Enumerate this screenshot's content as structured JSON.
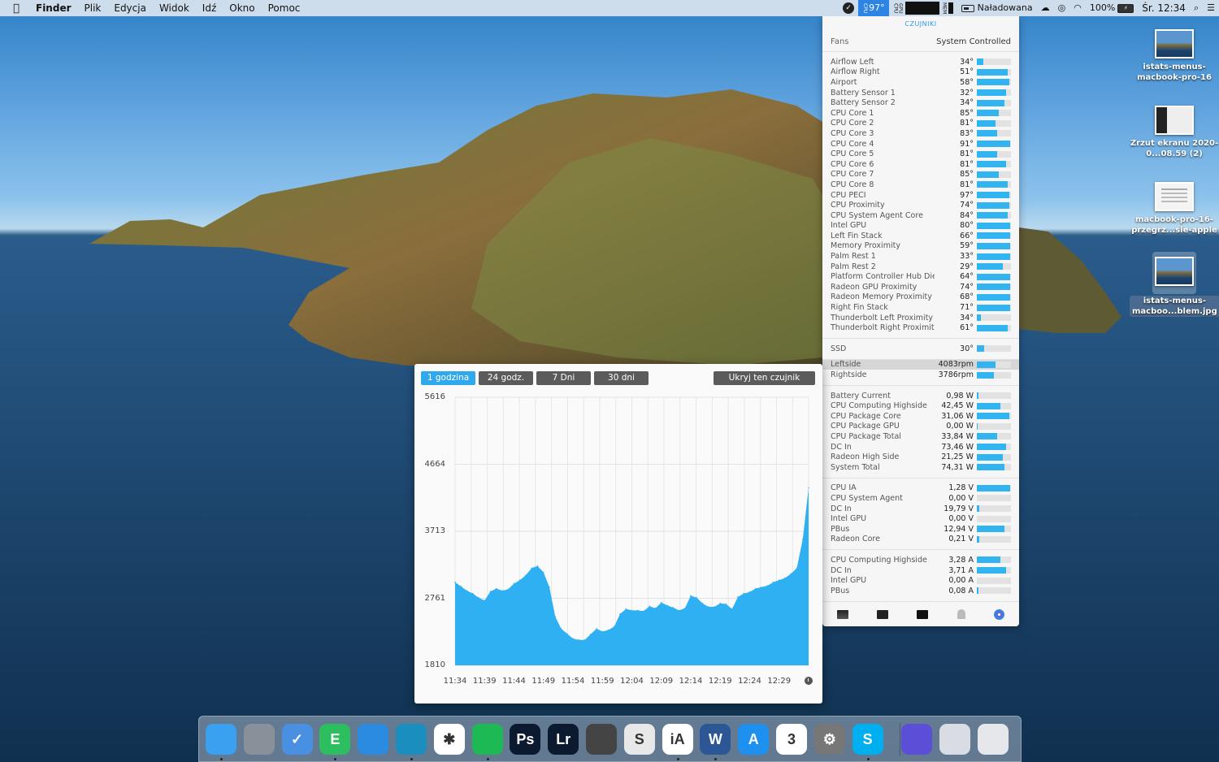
{
  "menubar": {
    "apple": "",
    "items": [
      "Finder",
      "Plik",
      "Edycja",
      "Widok",
      "Idź",
      "Okno",
      "Pomoc"
    ],
    "status": {
      "temperature": "97°",
      "battery_status": "Naładowana",
      "battery_percent": "100%",
      "clock": "Śr. 12:34"
    },
    "icons": [
      "checkmark-icon",
      "cpu-graph-icon",
      "battery-icon",
      "cloud-icon",
      "creative-cloud-icon",
      "wifi-icon",
      "spotlight-icon",
      "notification-center-icon"
    ]
  },
  "desktop_icons": [
    {
      "label": "istats-menus-macbook-pro-16",
      "kind": "photo"
    },
    {
      "label": "Zrzut ekranu 2020-0...08.59 (2)",
      "kind": "screen"
    },
    {
      "label": "macbook-pro-16-przegrz...sie-apple",
      "kind": "doc"
    },
    {
      "label": "istats-menus-macboo...blem.jpg",
      "kind": "photo",
      "selected": true
    }
  ],
  "istat": {
    "header": "CZUJNIKI",
    "fans_label": "Fans",
    "fans_mode": "System Controlled",
    "temperatures": [
      {
        "name": "Airflow Left",
        "value": "34°",
        "level": 0.18
      },
      {
        "name": "Airflow Right",
        "value": "51°",
        "level": 0.9
      },
      {
        "name": "Airport",
        "value": "58°",
        "level": 0.95
      },
      {
        "name": "Battery Sensor 1",
        "value": "32°",
        "level": 0.85
      },
      {
        "name": "Battery Sensor 2",
        "value": "34°",
        "level": 0.8
      },
      {
        "name": "CPU Core 1",
        "value": "85°",
        "level": 0.65
      },
      {
        "name": "CPU Core 2",
        "value": "81°",
        "level": 0.55
      },
      {
        "name": "CPU Core 3",
        "value": "83°",
        "level": 0.6
      },
      {
        "name": "CPU Core 4",
        "value": "91°",
        "level": 0.98
      },
      {
        "name": "CPU Core 5",
        "value": "81°",
        "level": 0.6
      },
      {
        "name": "CPU Core 6",
        "value": "81°",
        "level": 0.85
      },
      {
        "name": "CPU Core 7",
        "value": "85°",
        "level": 0.65
      },
      {
        "name": "CPU Core 8",
        "value": "81°",
        "level": 0.9
      },
      {
        "name": "CPU PECI",
        "value": "97°",
        "level": 0.95
      },
      {
        "name": "CPU Proximity",
        "value": "74°",
        "level": 0.95
      },
      {
        "name": "CPU System Agent Core",
        "value": "84°",
        "level": 0.9
      },
      {
        "name": "Intel GPU",
        "value": "80°",
        "level": 0.97
      },
      {
        "name": "Left Fin Stack",
        "value": "66°",
        "level": 0.97
      },
      {
        "name": "Memory Proximity",
        "value": "59°",
        "level": 0.97
      },
      {
        "name": "Palm Rest 1",
        "value": "33°",
        "level": 0.97
      },
      {
        "name": "Palm Rest 2",
        "value": "29°",
        "level": 0.75
      },
      {
        "name": "Platform Controller Hub Die",
        "value": "64°",
        "level": 0.97
      },
      {
        "name": "Radeon GPU Proximity",
        "value": "74°",
        "level": 0.97
      },
      {
        "name": "Radeon Memory Proximity",
        "value": "68°",
        "level": 0.97
      },
      {
        "name": "Right Fin Stack",
        "value": "71°",
        "level": 0.97
      },
      {
        "name": "Thunderbolt Left Proximity",
        "value": "34°",
        "level": 0.12
      },
      {
        "name": "Thunderbolt Right Proximity",
        "value": "61°",
        "level": 0.9
      }
    ],
    "ssd": [
      {
        "name": "SSD",
        "value": "30°",
        "level": 0.22
      }
    ],
    "fans": [
      {
        "name": "Leftside",
        "value": "4083rpm",
        "level": 0.55,
        "highlighted": true
      },
      {
        "name": "Rightside",
        "value": "3786rpm",
        "level": 0.5
      }
    ],
    "power": [
      {
        "name": "Battery Current",
        "value": "0,98 W",
        "level": 0.05
      },
      {
        "name": "CPU Computing Highside",
        "value": "42,45 W",
        "level": 0.7
      },
      {
        "name": "CPU Package Core",
        "value": "31,06 W",
        "level": 0.95
      },
      {
        "name": "CPU Package GPU",
        "value": "0,00 W",
        "level": 0.02
      },
      {
        "name": "CPU Package Total",
        "value": "33,84 W",
        "level": 0.6
      },
      {
        "name": "DC In",
        "value": "73,46 W",
        "level": 0.85
      },
      {
        "name": "Radeon High Side",
        "value": "21,25 W",
        "level": 0.75
      },
      {
        "name": "System Total",
        "value": "74,31 W",
        "level": 0.82
      }
    ],
    "voltage": [
      {
        "name": "CPU IA",
        "value": "1,28 V",
        "level": 0.97
      },
      {
        "name": "CPU System Agent",
        "value": "0,00 V",
        "level": 0.0
      },
      {
        "name": "DC In",
        "value": "19,79 V",
        "level": 0.08
      },
      {
        "name": "Intel GPU",
        "value": "0,00 V",
        "level": 0.0
      },
      {
        "name": "PBus",
        "value": "12,94 V",
        "level": 0.8
      },
      {
        "name": "Radeon Core",
        "value": "0,21 V",
        "level": 0.06
      }
    ],
    "current": [
      {
        "name": "CPU Computing Highside",
        "value": "3,28 A",
        "level": 0.7
      },
      {
        "name": "DC In",
        "value": "3,71 A",
        "level": 0.85
      },
      {
        "name": "Intel GPU",
        "value": "0,00 A",
        "level": 0.0
      },
      {
        "name": "PBus",
        "value": "0,08 A",
        "level": 0.04
      }
    ],
    "footer_icons": [
      "activity-monitor-icon",
      "console-icon",
      "terminal-icon",
      "system-info-icon",
      "disk-utility-icon"
    ]
  },
  "graph": {
    "tabs": [
      "1 godzina",
      "24 godz.",
      "7 Dni",
      "30 dni"
    ],
    "active_tab": 0,
    "hide_button": "Ukryj ten czujnik",
    "color": "#2eb0f2"
  },
  "chart_data": {
    "type": "area",
    "title": "",
    "xlabel": "",
    "ylabel": "",
    "y_ticks": [
      5616,
      4664,
      3713,
      2761,
      1810
    ],
    "x_ticks": [
      "11:34",
      "11:39",
      "11:44",
      "11:49",
      "11:54",
      "11:59",
      "12:04",
      "12:09",
      "12:14",
      "12:19",
      "12:24",
      "12:29"
    ],
    "ylim": [
      1810,
      5616
    ],
    "x": [
      "11:34",
      "11:35",
      "11:36",
      "11:37",
      "11:38",
      "11:39",
      "11:40",
      "11:41",
      "11:42",
      "11:43",
      "11:44",
      "11:45",
      "11:46",
      "11:47",
      "11:48",
      "11:49",
      "11:50",
      "11:51",
      "11:52",
      "11:53",
      "11:54",
      "11:55",
      "11:56",
      "11:57",
      "11:58",
      "11:59",
      "12:00",
      "12:01",
      "12:02",
      "12:03",
      "12:04",
      "12:05",
      "12:06",
      "12:07",
      "12:08",
      "12:09",
      "12:10",
      "12:11",
      "12:12",
      "12:13",
      "12:14",
      "12:15",
      "12:16",
      "12:17",
      "12:18",
      "12:19",
      "12:20",
      "12:21",
      "12:22",
      "12:23",
      "12:24",
      "12:25",
      "12:26",
      "12:27",
      "12:28",
      "12:29",
      "12:30",
      "12:31",
      "12:32",
      "12:33",
      "12:34"
    ],
    "values": [
      2990,
      2930,
      2870,
      2830,
      2770,
      2730,
      2860,
      2900,
      2870,
      2890,
      2970,
      3020,
      3090,
      3190,
      3220,
      3130,
      2920,
      2500,
      2330,
      2260,
      2190,
      2170,
      2170,
      2250,
      2330,
      2290,
      2310,
      2360,
      2540,
      2610,
      2590,
      2590,
      2580,
      2650,
      2620,
      2700,
      2660,
      2630,
      2590,
      2620,
      2800,
      2770,
      2690,
      2640,
      2640,
      2690,
      2680,
      2610,
      2780,
      2830,
      2850,
      2900,
      2920,
      2940,
      2990,
      3020,
      3050,
      3110,
      3190,
      3600,
      4330
    ],
    "grid": true,
    "legend": "none"
  },
  "dock": {
    "apps": [
      {
        "name": "finder-icon",
        "glyph": "",
        "bg": "#3aa0f0",
        "running": true
      },
      {
        "name": "launchpad-icon",
        "glyph": "",
        "bg": "#8a9099",
        "running": false
      },
      {
        "name": "things-icon",
        "glyph": "✓",
        "bg": "#4a90e2",
        "running": false
      },
      {
        "name": "evernote-icon",
        "glyph": "E",
        "bg": "#2dbe60",
        "running": true
      },
      {
        "name": "safari-icon",
        "glyph": "",
        "bg": "#2b8be0",
        "running": false
      },
      {
        "name": "edge-icon",
        "glyph": "",
        "bg": "#1a8fbf",
        "running": true
      },
      {
        "name": "slack-icon",
        "glyph": "✱",
        "bg": "#ffffff",
        "running": false
      },
      {
        "name": "spotify-icon",
        "glyph": "",
        "bg": "#1db954",
        "running": true
      },
      {
        "name": "photoshop-icon",
        "glyph": "Ps",
        "bg": "#0b1a2e",
        "running": false
      },
      {
        "name": "lightroom-icon",
        "glyph": "Lr",
        "bg": "#0b1a2e",
        "running": false
      },
      {
        "name": "davinci-icon",
        "glyph": "",
        "bg": "#444444",
        "running": false
      },
      {
        "name": "scrivener-icon",
        "glyph": "S",
        "bg": "#e8e8e8",
        "running": false
      },
      {
        "name": "ia-writer-icon",
        "glyph": "iA",
        "bg": "#ffffff",
        "running": true
      },
      {
        "name": "word-icon",
        "glyph": "W",
        "bg": "#2b5797",
        "running": true
      },
      {
        "name": "app-store-icon",
        "glyph": "A",
        "bg": "#1e90f0",
        "running": false
      },
      {
        "name": "calendar-icon",
        "glyph": "3",
        "bg": "#ffffff",
        "running": false
      },
      {
        "name": "system-preferences-icon",
        "glyph": "⚙",
        "bg": "#777777",
        "running": false
      },
      {
        "name": "skype-icon",
        "glyph": "S",
        "bg": "#00aff0",
        "running": true
      },
      {
        "name": "instastats-icon",
        "glyph": "",
        "bg": "#5a4fd6",
        "running": false
      },
      {
        "name": "downloads-stack-icon",
        "glyph": "",
        "bg": "#d9dde3",
        "running": false
      },
      {
        "name": "trash-icon",
        "glyph": "",
        "bg": "#e5e7ea",
        "running": false
      }
    ]
  }
}
